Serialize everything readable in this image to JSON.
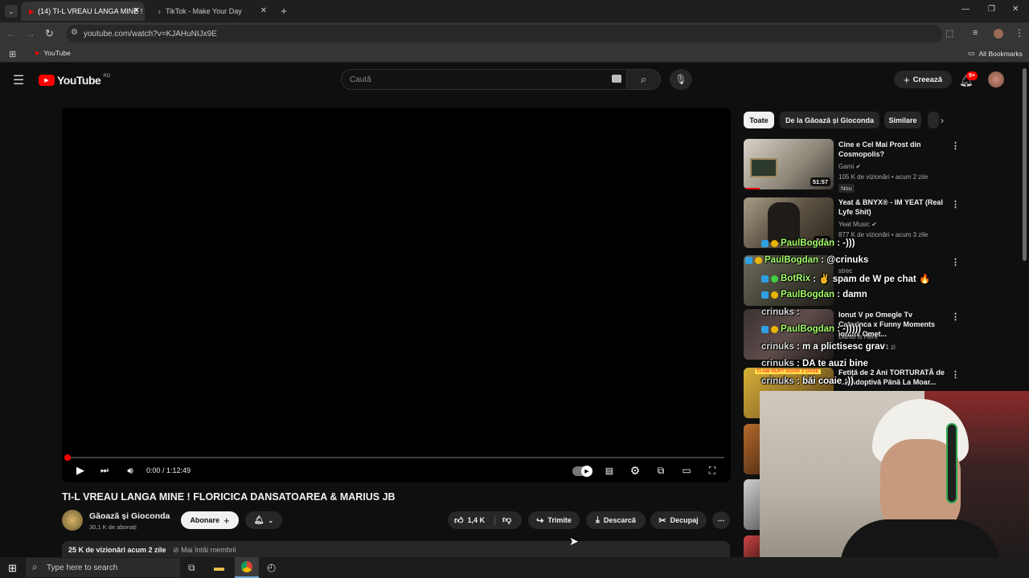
{
  "browser": {
    "tabs": [
      {
        "title": "(14) TI-L VREAU LANGA MINE !",
        "active": true
      },
      {
        "title": "TikTok - Make Your Day",
        "active": false
      }
    ],
    "new_tab_label": "+",
    "url": "youtube.com/watch?v=KJAHuNIJx9E",
    "bookmarks": {
      "youtube": "YouTube",
      "all": "All Bookmarks"
    }
  },
  "youtube": {
    "logo_text": "YouTube",
    "region": "RO",
    "search_placeholder": "Caută",
    "create_label": "Creează",
    "notification_count": "9+"
  },
  "player": {
    "time": "0:00 / 1:12:49",
    "progress_fraction": 0.0
  },
  "video": {
    "title": "TI-L VREAU LANGA MINE ! FLORICICA DANSATOAREA & MARIUS JB",
    "channel": "Găoază și Gioconda",
    "subscribers": "30,1 K de abonați",
    "subscribe_label": "Abonare",
    "likes": "1,4 K",
    "share_label": "Trimite",
    "download_label": "Descarcă",
    "clip_label": "Decupaj",
    "views_date": "25 K de vizionări  acum 2 zile",
    "members_first": "Mai întâi membrii"
  },
  "chips": [
    "Toate",
    "De la Găoază și Gioconda",
    "Similare"
  ],
  "related": [
    {
      "title": "Cine e Cel Mai Prost din Cosmopolis?",
      "channel": "Gami",
      "meta": "105 K de vizionări • acum 2 zile",
      "badge": "Nou",
      "duration": "51:57"
    },
    {
      "title": "Yeat & BNYX® - IM YEAT (Real Lyfe Shit)",
      "channel": "Yeat Music",
      "meta": "877 K de vizionări • acum 3 zile",
      "duration": "3:21"
    },
    {
      "title": "",
      "channel": "strec",
      "meta": ""
    },
    {
      "title": "Ionut V pe Omegle Tv Caterinca x Funny Moments Ionutv Omet...",
      "channel": "Danut is Here",
      "meta": "um 1 zi"
    },
    {
      "title": "Fetiță de 2 Ani TORTURATĂ de ...a Adoptivă Până La Moar...",
      "channel": "",
      "meta": "",
      "thumb_text": "TI-AM RUPT DOAR 3 OASE"
    }
  ],
  "chat_overlay": [
    {
      "user": "PaulBogdan",
      "message": ": -)))"
    },
    {
      "user": "PaulBogdan",
      "message": ": @crinuks"
    },
    {
      "user": "BotRix",
      "message": ": ✌ spam de W pe chat 🔥"
    },
    {
      "user": "PaulBogdan",
      "message": ": damn"
    },
    {
      "user": "crinuks",
      "message": ":"
    },
    {
      "user": "PaulBogdan",
      "message": ": -)))))"
    },
    {
      "user": "crinuks",
      "message": ": m a plictisesc grav"
    },
    {
      "user": "crinuks",
      "message": ": DA te auzi bine"
    },
    {
      "user": "crinuks",
      "message": ": băi coaie ;))"
    }
  ],
  "taskbar": {
    "search_placeholder": "Type here to search"
  },
  "colors": {
    "accent_red": "#ff0000",
    "background": "#0f0f0f",
    "chip_active": "#f1f1f1"
  }
}
